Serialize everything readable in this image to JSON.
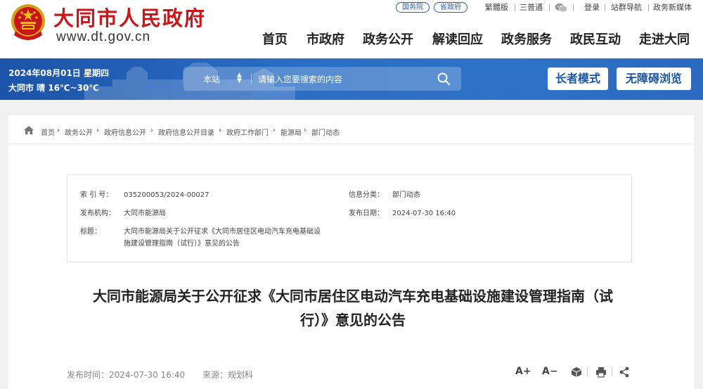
{
  "header": {
    "site_name": "大同市人民政府",
    "site_url": "www.dt.gov.cn",
    "top_links": {
      "state_council": "国务院",
      "province": "省政府",
      "traditional": "繁體版",
      "three_universal": "三普通",
      "login": "登录",
      "sitemap": "站群导航",
      "new_media": "政务新媒体"
    },
    "nav": [
      "首页",
      "市政府",
      "政务公开",
      "解读回应",
      "政务服务",
      "政民互动",
      "走进大同"
    ]
  },
  "banner": {
    "date": "2024年08月01日 星期四",
    "weather": "大同市 晴 16℃~30℃",
    "search_scope": "本站",
    "search_placeholder": "请输入您要搜索的内容",
    "elder_mode": "长者模式",
    "accessible": "无障碍浏览"
  },
  "breadcrumb": [
    "首页",
    "政务公开",
    "政府信息公开",
    "政府信息公开目录",
    "政府工作部门",
    "能源局",
    "部门动态"
  ],
  "info": {
    "index_label": "索 引 号：",
    "index_value": "035200053/2024-00027",
    "category_label": "信息分类：",
    "category_value": "部门动态",
    "org_label": "发布机构：",
    "org_value": "大同市能源局",
    "date_label": "发布日期：",
    "date_value": "2024-07-30 16:40",
    "title_label": "标题：",
    "title_value_line1": "大同市能源局关于公开征求《大同市居住区电动汽车充电基础设",
    "title_value_line2": "施建设管理指南（试行）》意见的公告"
  },
  "article": {
    "title_line1": "大同市能源局关于公开征求《大同市居住区电动汽车充电基础设施建设管理指南（试",
    "title_line2": "行）》意见的公告",
    "publish_time": "发布时间：2024-07-30 16:40",
    "source": "来源：规划科",
    "font_up": "A+",
    "font_down": "A−"
  },
  "colors": {
    "brand_red": "#c8161d",
    "banner_blue": "#1b54a8",
    "link_blue": "#2a5db8"
  }
}
